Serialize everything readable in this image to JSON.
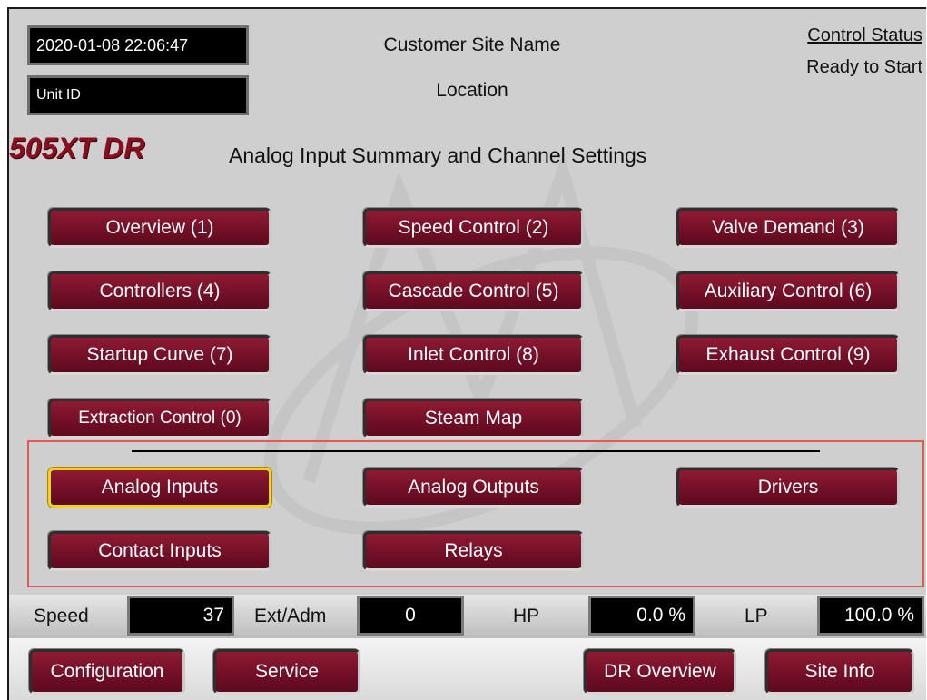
{
  "header": {
    "datetime": "2020-01-08  22:06:47",
    "unit_id": "Unit ID",
    "site_name": "Customer Site Name",
    "location": "Location",
    "control_status_label": "Control Status",
    "control_status_value": "Ready to Start"
  },
  "brand": {
    "logo_text": "505XT DR"
  },
  "page_title": "Analog Input Summary and Channel Settings",
  "nav": {
    "overview": "Overview (1)",
    "speed_control": "Speed Control (2)",
    "valve_demand": "Valve Demand (3)",
    "controllers": "Controllers (4)",
    "cascade_control": "Cascade Control (5)",
    "auxiliary_control": "Auxiliary Control (6)",
    "startup_curve": "Startup Curve (7)",
    "inlet_control": "Inlet Control (8)",
    "exhaust_control": "Exhaust Control (9)",
    "extraction_control": "Extraction Control (0)",
    "steam_map": "Steam Map"
  },
  "io_nav": {
    "analog_inputs": "Analog Inputs",
    "analog_outputs": "Analog Outputs",
    "drivers": "Drivers",
    "contact_inputs": "Contact Inputs",
    "relays": "Relays"
  },
  "readouts": {
    "speed_label": "Speed",
    "speed_value": "37",
    "ext_adm_label": "Ext/Adm",
    "ext_adm_value": "0",
    "hp_label": "HP",
    "hp_value": "0.0 %",
    "lp_label": "LP",
    "lp_value": "100.0 %"
  },
  "bottom": {
    "configuration": "Configuration",
    "service": "Service",
    "dr_overview": "DR Overview",
    "site_info": "Site Info"
  },
  "colors": {
    "button": "#7a1129",
    "selected_border": "#f2d21b",
    "logo": "#8a0e1f",
    "highlight": "#e05a5a"
  }
}
